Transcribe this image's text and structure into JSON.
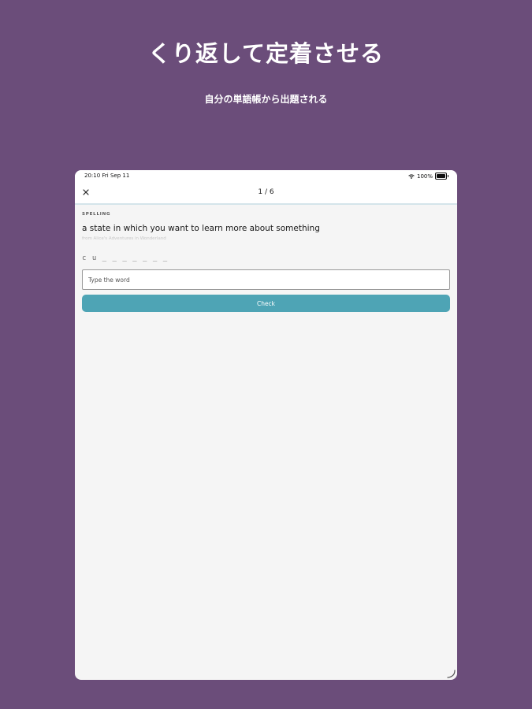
{
  "promo": {
    "headline": "くり返して定着させる",
    "subheadline": "自分の単語帳から出題される"
  },
  "statusbar": {
    "time": "20:10   Fri Sep 11",
    "battery": "100%",
    "icons": [
      "wifi-icon",
      "battery-icon"
    ]
  },
  "navbar": {
    "close_icon": "close-icon",
    "progress": "1 / 6"
  },
  "quiz": {
    "mode_label": "SPELLING",
    "definition": "a state in which you want to learn more about something",
    "source": "from Alice's Adventures in Wonderland",
    "hint": "c u _ _ _ _ _ _ _",
    "input": {
      "value": "",
      "placeholder": "Type the word"
    },
    "check_label": "Check"
  },
  "colors": {
    "background": "#6b4d7a",
    "accent": "#4ea4b5",
    "screen": "#f5f5f5"
  }
}
